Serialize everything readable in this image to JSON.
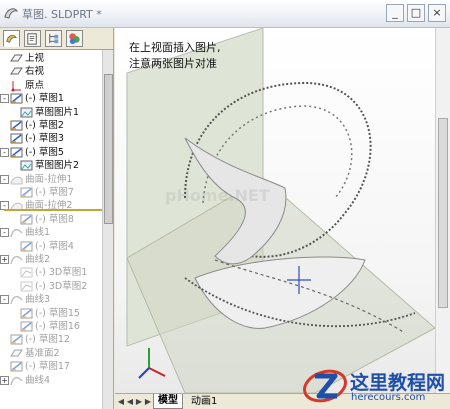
{
  "window": {
    "title": "草图. SLDPRT *",
    "buttons": {
      "minimize": "_",
      "maximize": "□",
      "close": "×"
    }
  },
  "panel_tabs": [
    {
      "name": "feature-manager-tab",
      "active": true
    },
    {
      "name": "property-manager-tab",
      "active": false
    },
    {
      "name": "configuration-manager-tab",
      "active": false
    },
    {
      "name": "display-manager-tab",
      "active": false
    }
  ],
  "tree": [
    {
      "label": "上视",
      "indent": 1,
      "icon": "plane",
      "dim": false,
      "exp": ""
    },
    {
      "label": "右视",
      "indent": 1,
      "icon": "plane",
      "dim": false,
      "exp": ""
    },
    {
      "label": "原点",
      "indent": 1,
      "icon": "origin",
      "dim": false,
      "exp": ""
    },
    {
      "label": "(-) 草图1",
      "indent": 1,
      "icon": "sketch",
      "dim": false,
      "exp": "-"
    },
    {
      "label": "草图图片1",
      "indent": 2,
      "icon": "picture",
      "dim": false,
      "exp": ""
    },
    {
      "label": "(-) 草图2",
      "indent": 1,
      "icon": "sketch",
      "dim": false,
      "exp": ""
    },
    {
      "label": "(-) 草图3",
      "indent": 1,
      "icon": "sketch",
      "dim": false,
      "exp": ""
    },
    {
      "label": "(-) 草图5",
      "indent": 1,
      "icon": "sketch",
      "dim": false,
      "exp": "-"
    },
    {
      "label": "草图图片2",
      "indent": 2,
      "icon": "picture",
      "dim": false,
      "exp": ""
    },
    {
      "label": "曲面-拉伸1",
      "indent": 1,
      "icon": "surface",
      "dim": true,
      "exp": "-"
    },
    {
      "label": "(-) 草图7",
      "indent": 2,
      "icon": "sketch",
      "dim": true,
      "exp": ""
    },
    {
      "label": "曲面-拉伸2",
      "indent": 1,
      "icon": "surface",
      "dim": true,
      "exp": "-"
    },
    {
      "label": "(-) 草图8",
      "indent": 2,
      "icon": "sketch",
      "dim": true,
      "exp": ""
    },
    {
      "label": "曲线1",
      "indent": 1,
      "icon": "curve",
      "dim": true,
      "exp": "-"
    },
    {
      "label": "(-) 草图4",
      "indent": 2,
      "icon": "sketch",
      "dim": true,
      "exp": ""
    },
    {
      "label": "曲线2",
      "indent": 1,
      "icon": "curve",
      "dim": true,
      "exp": "+"
    },
    {
      "label": "(-) 3D草图1",
      "indent": 2,
      "icon": "sketch3d",
      "dim": true,
      "exp": ""
    },
    {
      "label": "(-) 3D草图2",
      "indent": 2,
      "icon": "sketch3d",
      "dim": true,
      "exp": ""
    },
    {
      "label": "曲线3",
      "indent": 1,
      "icon": "curve",
      "dim": true,
      "exp": "-"
    },
    {
      "label": "(-) 草图15",
      "indent": 2,
      "icon": "sketch",
      "dim": true,
      "exp": ""
    },
    {
      "label": "(-) 草图16",
      "indent": 2,
      "icon": "sketch",
      "dim": true,
      "exp": ""
    },
    {
      "label": "(-) 草图12",
      "indent": 1,
      "icon": "sketch",
      "dim": true,
      "exp": ""
    },
    {
      "label": "基准面2",
      "indent": 1,
      "icon": "plane",
      "dim": true,
      "exp": ""
    },
    {
      "label": "(-) 草图17",
      "indent": 1,
      "icon": "sketch",
      "dim": true,
      "exp": ""
    },
    {
      "label": "曲线4",
      "indent": 1,
      "icon": "curve",
      "dim": true,
      "exp": "+"
    }
  ],
  "viewport": {
    "annotation_line1": "在上视面插入图片,",
    "annotation_line2": "注意两张图片对准",
    "watermark": "pHome.NET"
  },
  "bottom_tabs": {
    "nav": [
      "◀",
      "◀",
      "▶",
      "▶"
    ],
    "model": "模型",
    "animation": "动画1"
  },
  "branding": {
    "name": "这里教程网",
    "url": "herecours.com"
  },
  "colors": {
    "accent": "#1f4fa8",
    "plane": "#dfe5d6",
    "selection": "#c8a33a"
  }
}
